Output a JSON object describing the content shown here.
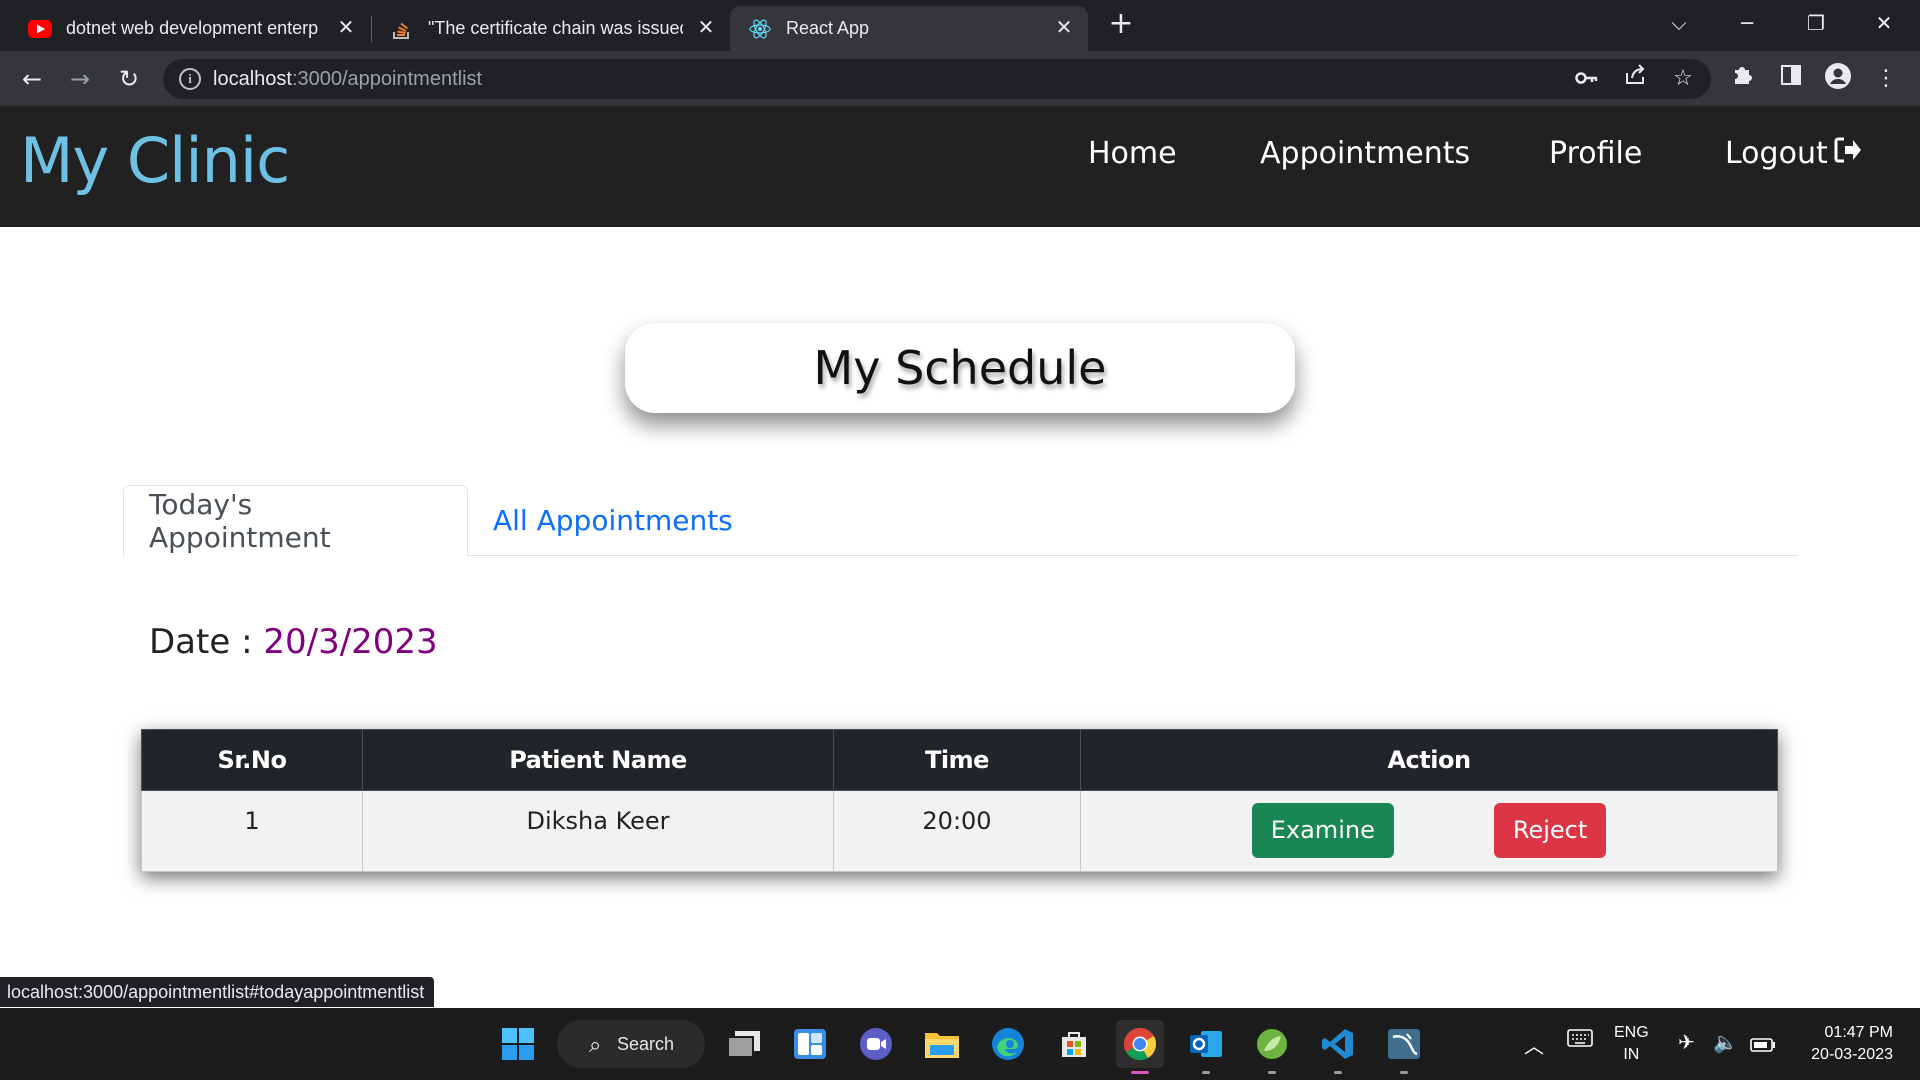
{
  "browser": {
    "tabs": [
      {
        "title": "dotnet web development enterp",
        "icon": "youtube-icon"
      },
      {
        "title": "\"The certificate chain was issued",
        "icon": "stackoverflow-icon"
      },
      {
        "title": "React App",
        "icon": "react-icon"
      }
    ],
    "url_host": "localhost",
    "url_path": ":3000/appointmentlist",
    "status_url": "localhost:3000/appointmentlist#todayappointmentlist"
  },
  "app": {
    "brand": "My Clinic",
    "nav": {
      "home": "Home",
      "appointments": "Appointments",
      "profile": "Profile",
      "logout": "Logout"
    },
    "heading": "My Schedule",
    "tabs": {
      "today": "Today's Appointment",
      "all": "All Appointments"
    },
    "date_label": "Date :",
    "date_value": "20/3/2023",
    "table": {
      "headers": [
        "Sr.No",
        "Patient Name",
        "Time",
        "Action"
      ],
      "rows": [
        {
          "srno": "1",
          "patient": "Diksha Keer",
          "time": "20:00",
          "examine": "Examine",
          "reject": "Reject"
        }
      ]
    }
  },
  "taskbar": {
    "search_label": "Search",
    "lang_top": "ENG",
    "lang_bottom": "IN",
    "time": "01:47 PM",
    "date": "20-03-2023"
  },
  "colors": {
    "brand": "#6ec1e4",
    "date_value": "#800080",
    "examine": "#198754",
    "reject": "#dc3545",
    "tab_link": "#0d6efd"
  }
}
